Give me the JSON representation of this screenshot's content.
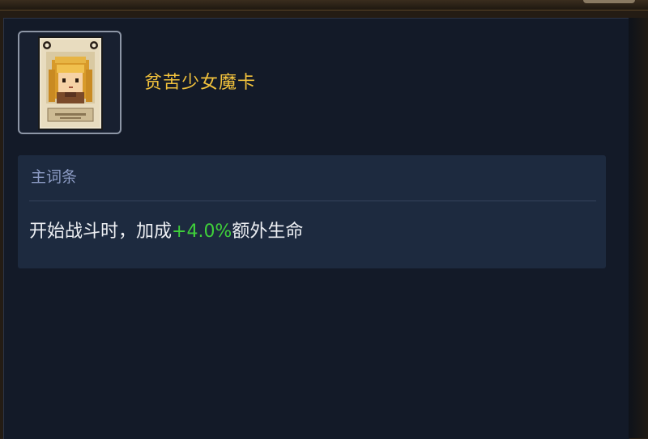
{
  "card": {
    "name": "贫苦少女魔卡",
    "icon": "card-girl-portrait-icon"
  },
  "affix_section": {
    "header": "主词条",
    "effect": {
      "prefix": "开始战斗时，加成",
      "value": "+4.0%",
      "suffix": "额外生命"
    }
  },
  "colors": {
    "title": "#f2c23c",
    "value_highlight": "#3fd03a",
    "section_header": "#8c9bc4",
    "panel_bg": "#131a28",
    "section_bg": "#1d2a3f"
  }
}
